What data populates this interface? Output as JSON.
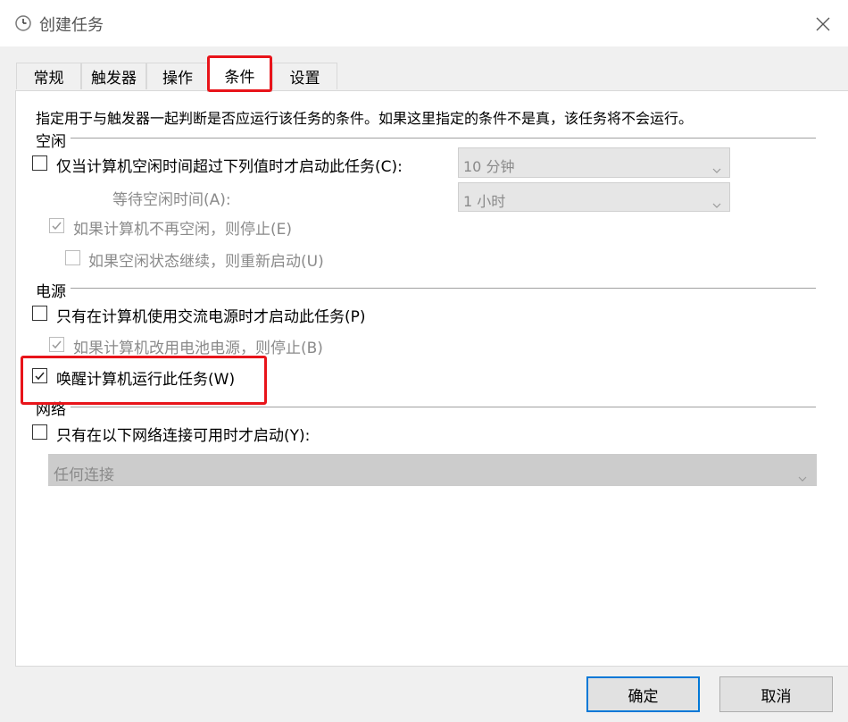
{
  "window": {
    "title": "创建任务",
    "close_symbol": "✕"
  },
  "tabs": [
    {
      "label": "常规",
      "active": false
    },
    {
      "label": "触发器",
      "active": false
    },
    {
      "label": "操作",
      "active": false
    },
    {
      "label": "条件",
      "active": true
    },
    {
      "label": "设置",
      "active": false
    }
  ],
  "description": "指定用于与触发器一起判断是否应运行该任务的条件。如果这里指定的条件不是真，该任务将不会运行。",
  "idle": {
    "group_label": "空闲",
    "start_if_idle": {
      "label": "仅当计算机空闲时间超过下列值时才启动此任务(C):",
      "checked": false
    },
    "idle_duration": {
      "value": "10 分钟"
    },
    "wait_label": "等待空闲时间(A):",
    "wait_duration": {
      "value": "1 小时"
    },
    "stop_if_not_idle": {
      "label": "如果计算机不再空闲，则停止(E)",
      "checked": true,
      "enabled": false
    },
    "restart_if_idle": {
      "label": "如果空闲状态继续，则重新启动(U)",
      "checked": false,
      "enabled": false
    }
  },
  "power": {
    "group_label": "电源",
    "ac_only": {
      "label": "只有在计算机使用交流电源时才启动此任务(P)",
      "checked": false
    },
    "stop_on_battery": {
      "label": "如果计算机改用电池电源，则停止(B)",
      "checked": true,
      "enabled": false
    },
    "wake_to_run": {
      "label": "唤醒计算机运行此任务(W)",
      "checked": true
    }
  },
  "network": {
    "group_label": "网络",
    "only_if_network": {
      "label": "只有在以下网络连接可用时才启动(Y):",
      "checked": false
    },
    "connection": {
      "value": "任何连接"
    }
  },
  "buttons": {
    "ok": "确定",
    "cancel": "取消"
  },
  "colors": {
    "highlight": "#e8141a",
    "accent": "#0078d7",
    "disabled_text": "#8a8a8a"
  }
}
